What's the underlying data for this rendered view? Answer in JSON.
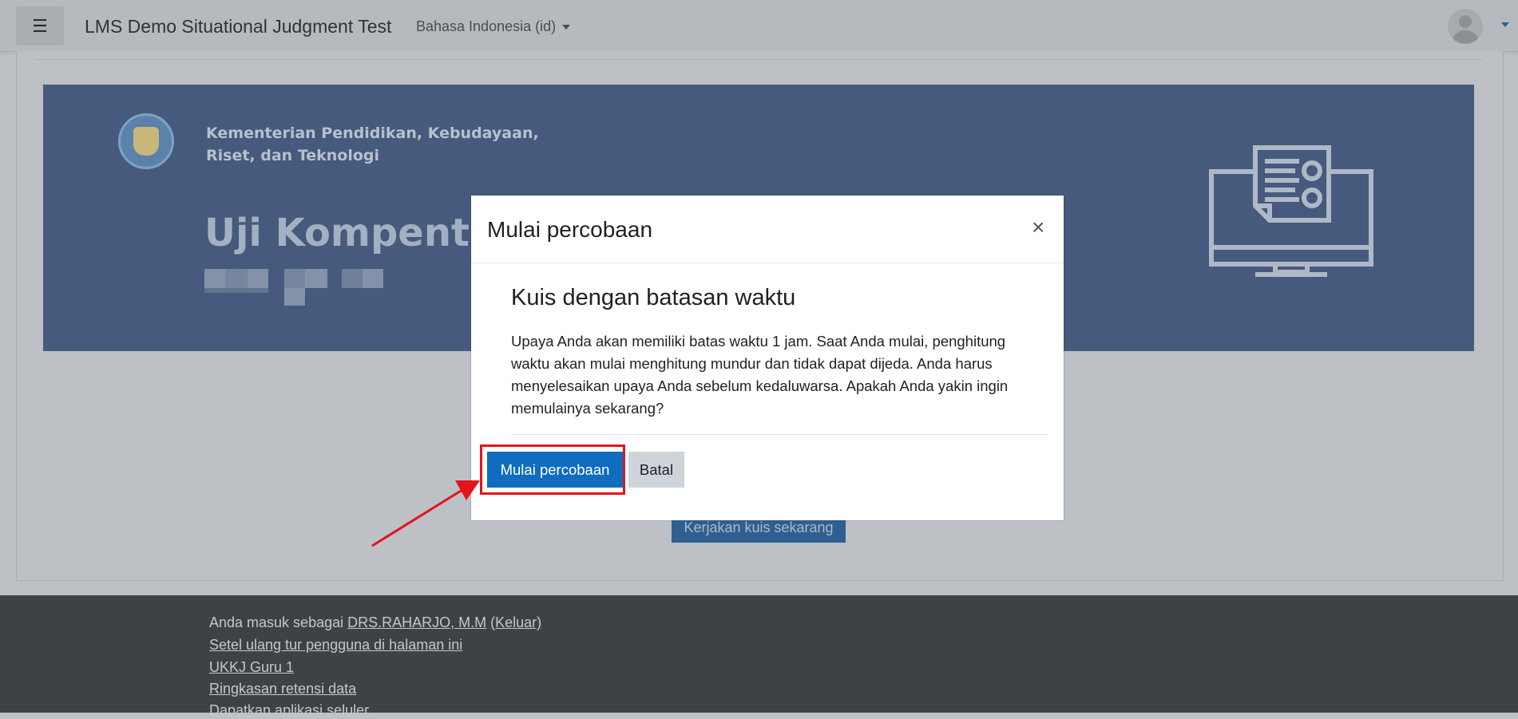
{
  "header": {
    "site_name": "LMS Demo Situational Judgment Test",
    "language": "Bahasa Indonesia (id)",
    "menu_icon": "☰"
  },
  "banner": {
    "ministry": "Kementerian Pendidikan, Kebudayaan,",
    "ministry_line2": "Riset, dan Teknologi",
    "title": "Uji Kompenten"
  },
  "page": {
    "start_quiz_label": "Kerjakan kuis sekarang"
  },
  "modal": {
    "title": "Mulai percobaan",
    "close_glyph": "×",
    "heading": "Kuis dengan batasan waktu",
    "body": "Upaya Anda akan memiliki batas waktu 1 jam. Saat Anda mulai, penghitung waktu akan mulai menghitung mundur dan tidak dapat dijeda. Anda harus menyelesaikan upaya Anda sebelum kedaluwarsa. Apakah Anda yakin ingin memulainya sekarang?",
    "primary_label": "Mulai percobaan",
    "secondary_label": "Batal"
  },
  "footer": {
    "logged_in_prefix": "Anda masuk sebagai ",
    "user_name": "DRS.RAHARJO, M.M",
    "logout": "(Keluar)",
    "reset_tour": "Setel ulang tur pengguna di halaman ini",
    "course": "UKKJ Guru 1",
    "retention": "Ringkasan retensi data",
    "mobile_app": "Dapatkan aplikasi seluler"
  },
  "colors": {
    "primary": "#0f6cbf",
    "banner": "#455a7c",
    "annotation": "#e3141c"
  }
}
